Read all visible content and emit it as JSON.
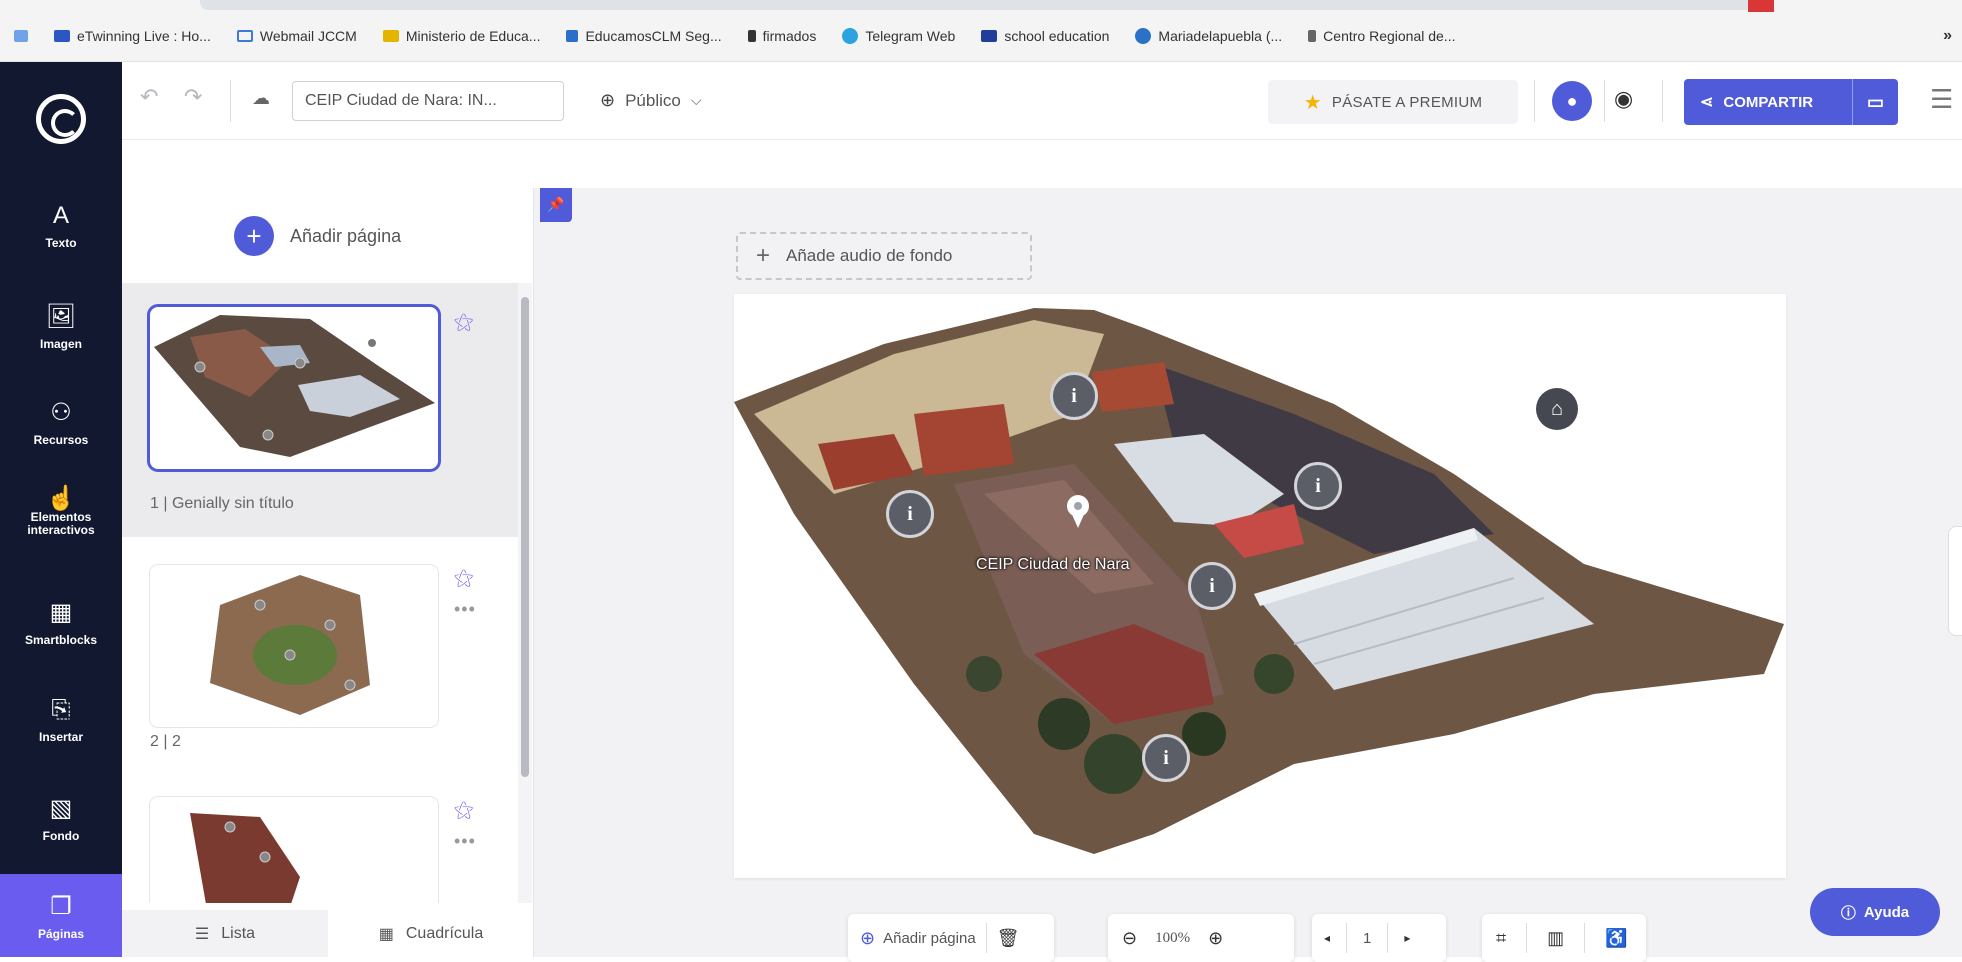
{
  "bookmarks": [
    {
      "label": "eTwinning Live : Ho...",
      "color": "#2b56c4"
    },
    {
      "label": "Webmail JCCM",
      "color": "#3e7bd8"
    },
    {
      "label": "Ministerio de Educa...",
      "color": "#e3b400"
    },
    {
      "label": "EducamosCLM Seg...",
      "color": "#2a6fc9"
    },
    {
      "label": "firmados",
      "color": "#333333"
    },
    {
      "label": "Telegram Web",
      "color": "#2aa3e0"
    },
    {
      "label": "school education",
      "color": "#1f3d99"
    },
    {
      "label": "Mariadelapuebla (...",
      "color": "#2b72c7"
    },
    {
      "label": "Centro Regional de...",
      "color": "#666666"
    }
  ],
  "bookmarks_more": "»",
  "sidebar": {
    "items": [
      {
        "label": "Texto",
        "icon": "A"
      },
      {
        "label": "Imagen",
        "icon": "🖼"
      },
      {
        "label": "Recursos",
        "icon": "⚇"
      },
      {
        "label": "Elementos interactivos",
        "icon": "☝"
      },
      {
        "label": "Smartblocks",
        "icon": "▦"
      },
      {
        "label": "Insertar",
        "icon": "⎘"
      },
      {
        "label": "Fondo",
        "icon": "▧"
      },
      {
        "label": "Páginas",
        "icon": "❐"
      }
    ]
  },
  "toolbar": {
    "title": "CEIP Ciudad de Nara: IN...",
    "visibility": "Público",
    "premium": "PÁSATE A PREMIUM",
    "share": "COMPARTIR"
  },
  "pages": {
    "add_label": "Añadir página",
    "list": [
      {
        "label": "1 |  Genially sin título"
      },
      {
        "label": "2 |  2"
      },
      {
        "label": ""
      }
    ],
    "tabs": {
      "list": "Lista",
      "grid": "Cuadrícula"
    }
  },
  "canvas": {
    "audio_label": "Añade audio de fondo",
    "place_label": "CEIP Ciudad de Nara",
    "hotspot_icon": "i"
  },
  "bottom": {
    "add_page": "Añadir página",
    "zoom": "100%",
    "page_number": "1"
  },
  "help_label": "Ayuda"
}
